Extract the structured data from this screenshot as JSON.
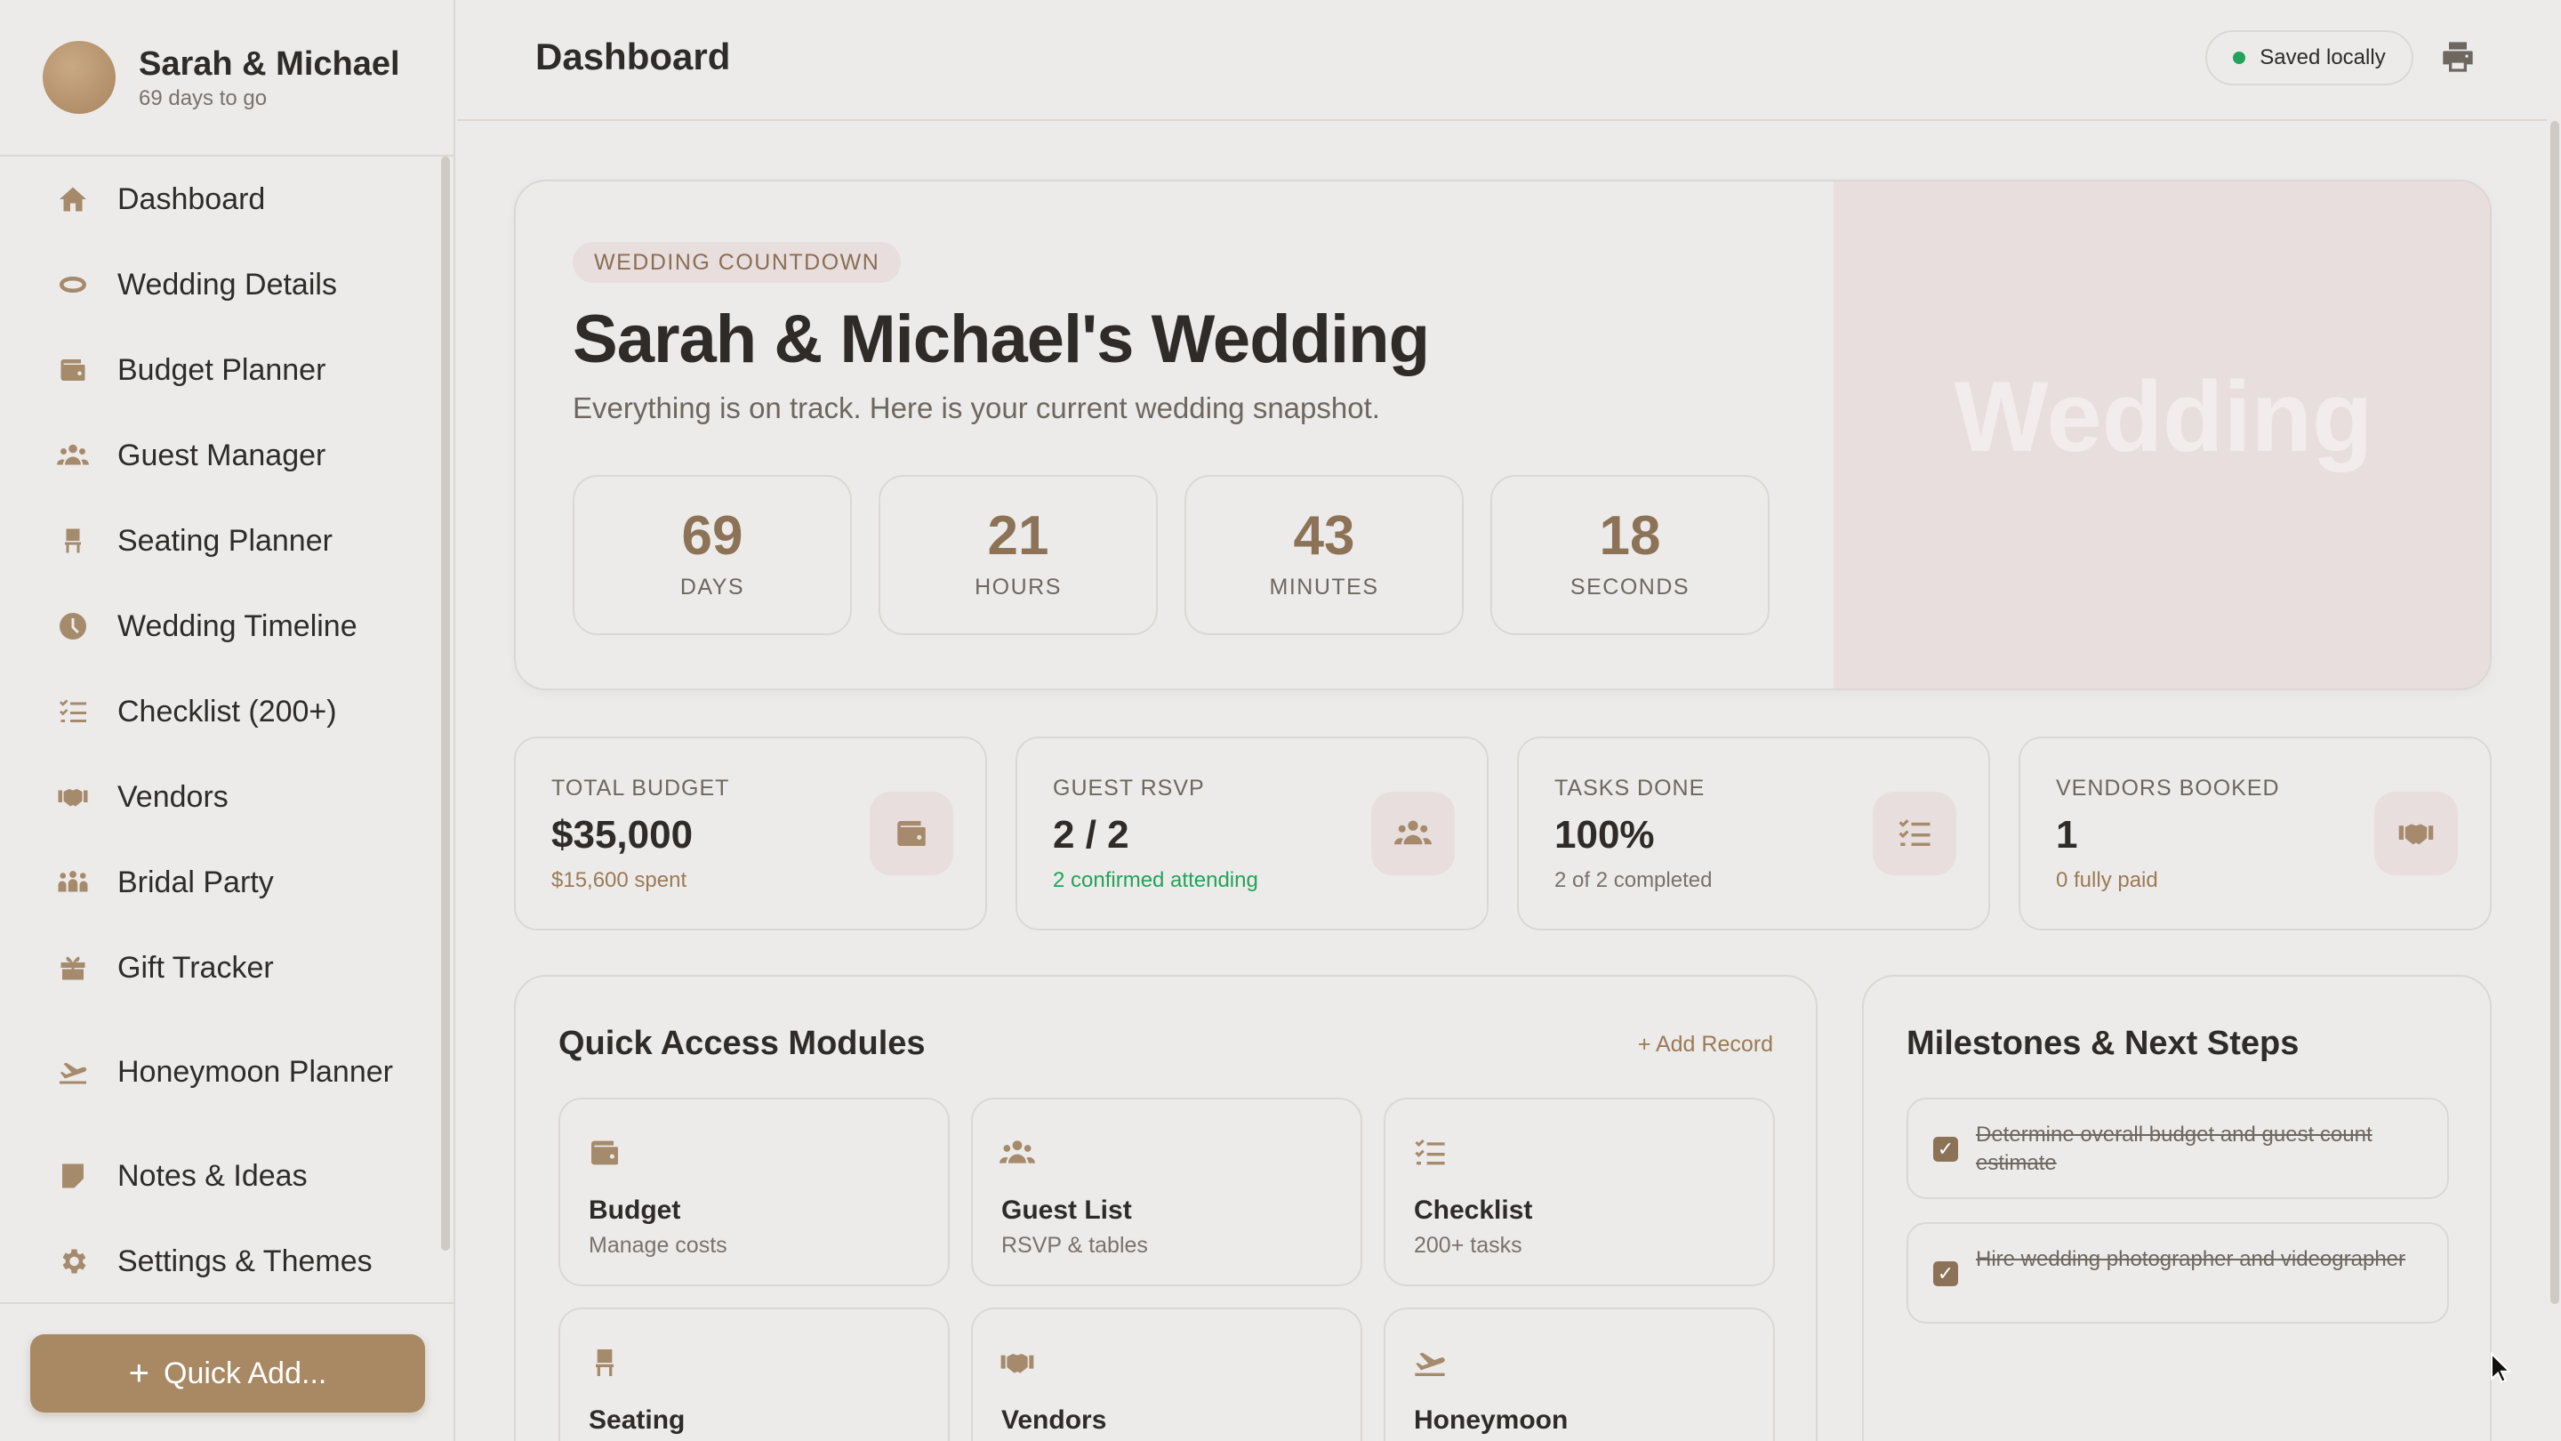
{
  "profile": {
    "name": "Sarah & Michael",
    "subtitle": "69 days to go"
  },
  "nav": [
    {
      "label": "Dashboard",
      "icon": "home-icon"
    },
    {
      "label": "Wedding Details",
      "icon": "ring-icon"
    },
    {
      "label": "Budget Planner",
      "icon": "wallet-icon"
    },
    {
      "label": "Guest Manager",
      "icon": "users-icon"
    },
    {
      "label": "Seating Planner",
      "icon": "chair-icon"
    },
    {
      "label": "Wedding Timeline",
      "icon": "clock-icon"
    },
    {
      "label": "Checklist (200+)",
      "icon": "checklist-icon"
    },
    {
      "label": "Vendors",
      "icon": "handshake-icon"
    },
    {
      "label": "Bridal Party",
      "icon": "group-icon"
    },
    {
      "label": "Gift Tracker",
      "icon": "gift-icon"
    },
    {
      "label": "Honeymoon Planner",
      "icon": "plane-icon"
    },
    {
      "label": "Notes & Ideas",
      "icon": "note-icon"
    },
    {
      "label": "Settings & Themes",
      "icon": "gear-icon"
    }
  ],
  "quick_add": {
    "label": "Quick Add..."
  },
  "header": {
    "title": "Dashboard",
    "status": "Saved locally",
    "status_color": "#22a35a"
  },
  "hero": {
    "tag": "WEDDING COUNTDOWN",
    "title": "Sarah & Michael's Wedding",
    "subtitle": "Everything is on track. Here is your current wedding snapshot.",
    "watermark": "Wedding",
    "countdown": [
      {
        "value": "69",
        "unit": "DAYS"
      },
      {
        "value": "21",
        "unit": "HOURS"
      },
      {
        "value": "43",
        "unit": "MINUTES"
      },
      {
        "value": "18",
        "unit": "SECONDS"
      }
    ]
  },
  "stats": [
    {
      "label": "TOTAL BUDGET",
      "value": "$35,000",
      "note": "$15,600 spent",
      "icon": "wallet-icon"
    },
    {
      "label": "GUEST RSVP",
      "value": "2 / 2",
      "note": "2 confirmed attending",
      "icon": "users-icon"
    },
    {
      "label": "TASKS DONE",
      "value": "100%",
      "note": "2 of 2 completed",
      "icon": "checklist-icon"
    },
    {
      "label": "VENDORS BOOKED",
      "value": "1",
      "note": "0 fully paid",
      "icon": "handshake-icon"
    }
  ],
  "quick_access": {
    "title": "Quick Access Modules",
    "add_label": "+ Add Record",
    "modules": [
      {
        "title": "Budget",
        "subtitle": "Manage costs",
        "icon": "wallet-icon"
      },
      {
        "title": "Guest List",
        "subtitle": "RSVP & tables",
        "icon": "users-icon"
      },
      {
        "title": "Checklist",
        "subtitle": "200+ tasks",
        "icon": "checklist-icon"
      },
      {
        "title": "Seating",
        "subtitle": "",
        "icon": "chair-icon"
      },
      {
        "title": "Vendors",
        "subtitle": "",
        "icon": "handshake-icon"
      },
      {
        "title": "Honeymoon",
        "subtitle": "",
        "icon": "plane-icon"
      }
    ]
  },
  "milestones": {
    "title": "Milestones & Next Steps",
    "items": [
      {
        "text": "Determine overall budget and guest count estimate",
        "done": true
      },
      {
        "text": "Hire wedding photographer and videographer",
        "done": true
      }
    ]
  },
  "colors": {
    "accent": "#a88963",
    "accent_dark": "#8c7256",
    "success": "#22a35a",
    "hero_panel": "#e8dedd"
  }
}
